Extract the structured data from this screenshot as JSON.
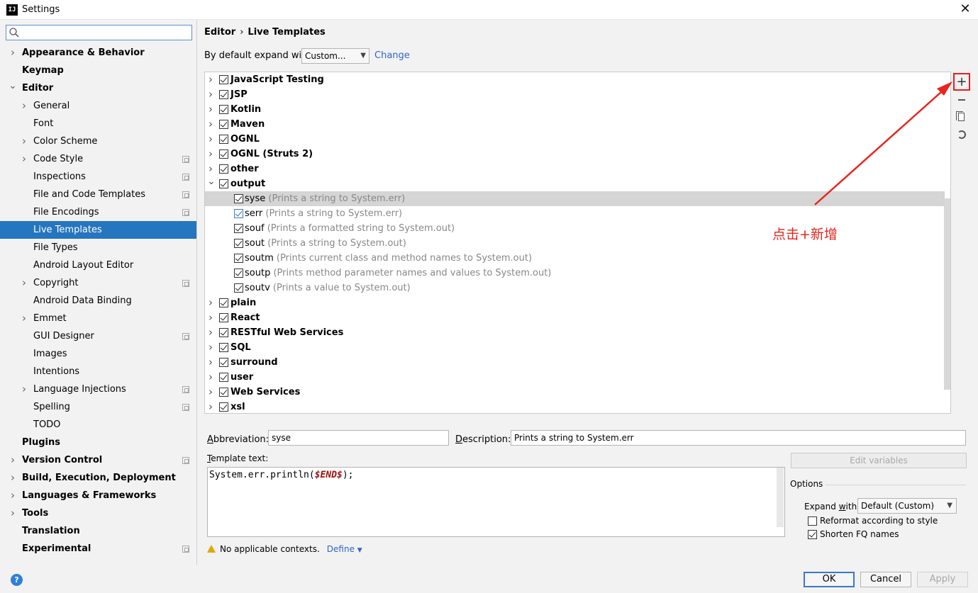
{
  "window": {
    "title": "Settings",
    "app_icon": "IJ"
  },
  "search": {
    "value": "",
    "placeholder": ""
  },
  "sidebar": {
    "items": [
      {
        "label": "Appearance & Behavior",
        "level": 0,
        "expandable": true,
        "expanded": false,
        "copy_icon": false
      },
      {
        "label": "Keymap",
        "level": 0,
        "expandable": false,
        "copy_icon": false
      },
      {
        "label": "Editor",
        "level": 0,
        "expandable": true,
        "expanded": true,
        "copy_icon": false
      },
      {
        "label": "General",
        "level": 1,
        "expandable": true,
        "expanded": false,
        "copy_icon": false
      },
      {
        "label": "Font",
        "level": 1,
        "expandable": false,
        "copy_icon": false
      },
      {
        "label": "Color Scheme",
        "level": 1,
        "expandable": true,
        "expanded": false,
        "copy_icon": false
      },
      {
        "label": "Code Style",
        "level": 1,
        "expandable": true,
        "expanded": false,
        "copy_icon": true
      },
      {
        "label": "Inspections",
        "level": 1,
        "expandable": false,
        "copy_icon": true
      },
      {
        "label": "File and Code Templates",
        "level": 1,
        "expandable": false,
        "copy_icon": true
      },
      {
        "label": "File Encodings",
        "level": 1,
        "expandable": false,
        "copy_icon": true
      },
      {
        "label": "Live Templates",
        "level": 1,
        "expandable": false,
        "copy_icon": false,
        "selected": true
      },
      {
        "label": "File Types",
        "level": 1,
        "expandable": false,
        "copy_icon": false
      },
      {
        "label": "Android Layout Editor",
        "level": 1,
        "expandable": false,
        "copy_icon": false
      },
      {
        "label": "Copyright",
        "level": 1,
        "expandable": true,
        "expanded": false,
        "copy_icon": true
      },
      {
        "label": "Android Data Binding",
        "level": 1,
        "expandable": false,
        "copy_icon": false
      },
      {
        "label": "Emmet",
        "level": 1,
        "expandable": true,
        "expanded": false,
        "copy_icon": false
      },
      {
        "label": "GUI Designer",
        "level": 1,
        "expandable": false,
        "copy_icon": true
      },
      {
        "label": "Images",
        "level": 1,
        "expandable": false,
        "copy_icon": false
      },
      {
        "label": "Intentions",
        "level": 1,
        "expandable": false,
        "copy_icon": false
      },
      {
        "label": "Language Injections",
        "level": 1,
        "expandable": true,
        "expanded": false,
        "copy_icon": true
      },
      {
        "label": "Spelling",
        "level": 1,
        "expandable": false,
        "copy_icon": true
      },
      {
        "label": "TODO",
        "level": 1,
        "expandable": false,
        "copy_icon": false
      },
      {
        "label": "Plugins",
        "level": 0,
        "expandable": false,
        "copy_icon": false
      },
      {
        "label": "Version Control",
        "level": 0,
        "expandable": true,
        "expanded": false,
        "copy_icon": true
      },
      {
        "label": "Build, Execution, Deployment",
        "level": 0,
        "expandable": true,
        "expanded": false,
        "copy_icon": false
      },
      {
        "label": "Languages & Frameworks",
        "level": 0,
        "expandable": true,
        "expanded": false,
        "copy_icon": false
      },
      {
        "label": "Tools",
        "level": 0,
        "expandable": true,
        "expanded": false,
        "copy_icon": false
      },
      {
        "label": "Translation",
        "level": 0,
        "expandable": false,
        "copy_icon": false
      },
      {
        "label": "Experimental",
        "level": 0,
        "expandable": false,
        "copy_icon": true
      }
    ]
  },
  "breadcrumb": {
    "parent": "Editor",
    "separator": "›",
    "current": "Live Templates"
  },
  "expand_default": {
    "label": "By default expand with",
    "value": "Custom...",
    "change_link": "Change"
  },
  "templates": [
    {
      "type": "group",
      "label": "JavaScript Testing",
      "checked": true,
      "expanded": false
    },
    {
      "type": "group",
      "label": "JSP",
      "checked": true,
      "expanded": false
    },
    {
      "type": "group",
      "label": "Kotlin",
      "checked": true,
      "expanded": false
    },
    {
      "type": "group",
      "label": "Maven",
      "checked": true,
      "expanded": false
    },
    {
      "type": "group",
      "label": "OGNL",
      "checked": true,
      "expanded": false
    },
    {
      "type": "group",
      "label": "OGNL (Struts 2)",
      "checked": true,
      "expanded": false
    },
    {
      "type": "group",
      "label": "other",
      "checked": true,
      "expanded": false
    },
    {
      "type": "group",
      "label": "output",
      "checked": true,
      "expanded": true
    },
    {
      "type": "child",
      "label": "syse",
      "desc": "(Prints a string to System.err)",
      "checked": true,
      "highlighted": true
    },
    {
      "type": "child",
      "label": "serr",
      "desc": "(Prints a string to System.err)",
      "checked": true,
      "blue": true
    },
    {
      "type": "child",
      "label": "souf",
      "desc": "(Prints a formatted string to System.out)",
      "checked": true
    },
    {
      "type": "child",
      "label": "sout",
      "desc": "(Prints a string to System.out)",
      "checked": true
    },
    {
      "type": "child",
      "label": "soutm",
      "desc": "(Prints current class and method names to System.out)",
      "checked": true
    },
    {
      "type": "child",
      "label": "soutp",
      "desc": "(Prints method parameter names and values to System.out)",
      "checked": true
    },
    {
      "type": "child",
      "label": "soutv",
      "desc": "(Prints a value to System.out)",
      "checked": true
    },
    {
      "type": "group",
      "label": "plain",
      "checked": true,
      "expanded": false
    },
    {
      "type": "group",
      "label": "React",
      "checked": true,
      "expanded": false
    },
    {
      "type": "group",
      "label": "RESTful Web Services",
      "checked": true,
      "expanded": false
    },
    {
      "type": "group",
      "label": "SQL",
      "checked": true,
      "expanded": false
    },
    {
      "type": "group",
      "label": "surround",
      "checked": true,
      "expanded": false
    },
    {
      "type": "group",
      "label": "user",
      "checked": true,
      "expanded": false
    },
    {
      "type": "group",
      "label": "Web Services",
      "checked": true,
      "expanded": false
    },
    {
      "type": "group",
      "label": "xsl",
      "checked": true,
      "expanded": false
    }
  ],
  "toolbar": {
    "add_icon": "plus-icon",
    "remove_icon": "minus-icon",
    "copy_icon": "duplicate-icon",
    "restore_icon": "undo-icon",
    "highlight_color": "#e81e1e"
  },
  "annotation": {
    "text": "点击+新增",
    "color": "#e8261e"
  },
  "editor": {
    "abbreviation_label": "Abbreviation:",
    "abbreviation_value": "syse",
    "description_label": "Description:",
    "description_value": "Prints a string to System.err",
    "template_text_label": "Template text:",
    "template_code_prefix": "System.err.println(",
    "template_code_var": "$END$",
    "template_code_suffix": ");",
    "edit_variables": "Edit variables",
    "warning_text": "No applicable contexts.",
    "define_link": "Define"
  },
  "options": {
    "title": "Options",
    "expand_with_label": "Expand with",
    "expand_with_value": "Default (Custom)",
    "reformat_label": "Reformat according to style",
    "reformat_checked": false,
    "shorten_label": "Shorten FQ names",
    "shorten_checked": true
  },
  "footer": {
    "help": "?",
    "ok": "OK",
    "cancel": "Cancel",
    "apply": "Apply"
  },
  "colors": {
    "selection": "#2675bf",
    "link": "#2f65ca",
    "template_var": "#a01010"
  }
}
